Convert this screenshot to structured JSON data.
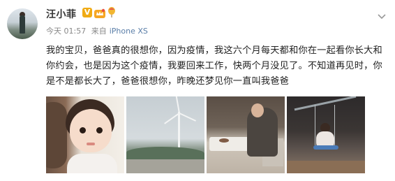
{
  "post": {
    "author": "汪小菲",
    "verified_badge": "V",
    "time": "今天 01:57",
    "source_prefix": "来自",
    "source_device": "iPhone XS",
    "content": "我的宝贝，爸爸真的很想你，因为疫情，我这六个月每天都和你在一起看你长大和你约会，也是因为这个疫情，我要回来工作，快两个月没见了。不知道再见时，你是不是都长大了，爸爸很想你，昨晚还梦见你一直叫我爸爸"
  },
  "icons": {
    "avatar": "avatar-photo",
    "verified": "verified-v-icon",
    "member": "crown-icon",
    "balloon": "balloon-icon",
    "menu": "chevron-down-icon"
  },
  "colors": {
    "verified": "#f0ab14",
    "link": "#5a7ea8",
    "meta": "#888888"
  },
  "photos": [
    {
      "name": "photo-baby-with-father"
    },
    {
      "name": "photo-wind-turbine"
    },
    {
      "name": "photo-restaurant"
    },
    {
      "name": "photo-swing"
    }
  ]
}
